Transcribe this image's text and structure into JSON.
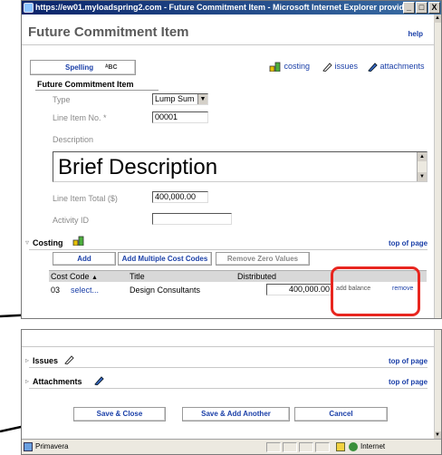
{
  "window": {
    "title": "https://ew01.myloadspring2.com - Future Commitment Item - Microsoft Internet Explorer provided ...",
    "controls": [
      "_",
      "□",
      "X"
    ]
  },
  "page": {
    "heading": "Future Commitment Item",
    "help_label": "help"
  },
  "toolbar": {
    "spelling_label": "Spelling",
    "spelling_icon_text": "ᴬBC",
    "costing_label": "costing",
    "issues_label": "issues",
    "attachments_label": "attachments"
  },
  "form": {
    "section_title": "Future Commitment Item",
    "type_label": "Type",
    "type_value": "Lump Sum",
    "line_item_no_label": "Line Item No. *",
    "line_item_no_value": "00001",
    "description_label": "Description",
    "description_value": "Brief Description",
    "line_item_total_label": "Line Item Total ($)",
    "line_item_total_value": "400,000.00",
    "activity_id_label": "Activity ID",
    "activity_id_value": ""
  },
  "costing": {
    "title": "Costing",
    "top_of_page": "top of page",
    "add_label": "Add",
    "add_multiple_label": "Add Multiple Cost Codes",
    "remove_zero_label": "Remove Zero Values",
    "columns": {
      "cost_code": "Cost Code",
      "title": "Title",
      "distributed": "Distributed"
    },
    "rows": [
      {
        "cost_code": "03",
        "select": "select...",
        "title": "Design Consultants",
        "distributed": "400,000.00",
        "add_balance": "add balance",
        "remove": "remove"
      }
    ]
  },
  "bottom": {
    "issues_label": "Issues",
    "attachments_label": "Attachments",
    "top_of_page_1": "top of page",
    "top_of_page_2": "top of page",
    "save_close_label": "Save & Close",
    "save_add_label": "Save & Add Another",
    "cancel_label": "Cancel"
  },
  "statusbar": {
    "left_text": "Primavera",
    "zone_text": "Internet"
  },
  "colors": {
    "link_blue": "#1a3fa8",
    "annotation_red": "#e8261f",
    "titlebar_blue": "#0a246a"
  }
}
